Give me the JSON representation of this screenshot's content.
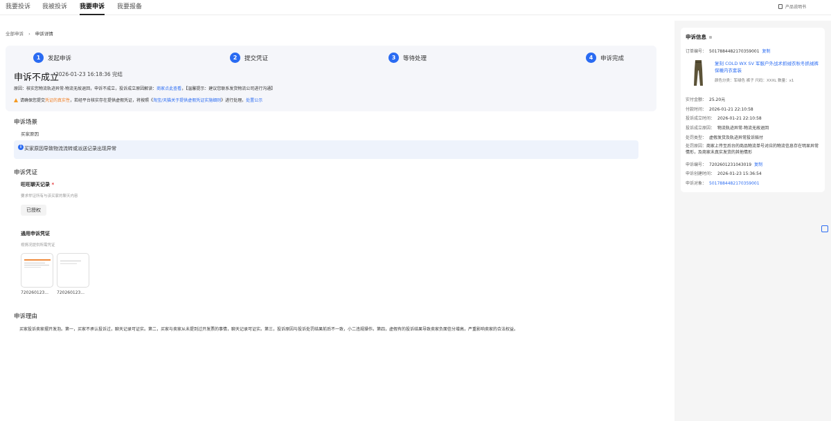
{
  "nav": {
    "tabs": [
      {
        "label": "我要投诉"
      },
      {
        "label": "我被投诉"
      },
      {
        "label": "我要申诉"
      },
      {
        "label": "我要报备"
      }
    ],
    "help": "产品说明书"
  },
  "breadcrumb": {
    "root": "全部申诉",
    "sep": "›",
    "current": "申诉详情"
  },
  "steps": [
    {
      "num": "1",
      "label": "发起申诉"
    },
    {
      "num": "2",
      "label": "提交凭证"
    },
    {
      "num": "3",
      "label": "等待处理"
    },
    {
      "num": "4",
      "label": "申诉完成"
    }
  ],
  "status": {
    "title": "申诉不成立",
    "time": "2026-01-23 16:18:36 完结",
    "reason_prefix": "原因：核实您物流轨迹异常-物流无故退回，申诉不成立，投诉成立原因解读：",
    "reason_link": "商家点此查看",
    "reason_suffix": "，【温馨提示：建议您联系发货物流公司进行沟通】",
    "warn_prefix": "请确保您提交",
    "warn_orange": "凭证的真实性",
    "warn_mid": "，若经平台核实存在提供虚假凭证，将按照《",
    "warn_link1": "淘宝/天猫关于提供虚假凭证实施细则",
    "warn_after": "》进行处理。",
    "warn_link2": "处置公示"
  },
  "scene": {
    "title": "申诉场景",
    "sub": "买家原因",
    "info": "买家原因导致物流流转或派送记录出现异常"
  },
  "evidence": {
    "title": "申诉凭证",
    "chat_label": "旺旺聊天记录",
    "required_mark": "*",
    "chat_hint": "要求举证所有与该买家的聊天内容",
    "auth_button": "已授权",
    "general_label": "通用申诉凭证",
    "general_hint": "视情况提供所需凭证",
    "files": [
      {
        "name": "720260123..."
      },
      {
        "name": "720260123..."
      }
    ]
  },
  "reason": {
    "title": "申诉理由",
    "text": "买家投诉卖家摆开发泡。第一，买家不承认投诉过，聊天记录可证实。第二，买家与卖家从未提到过开发票的事情，聊天记录可证实。第三，投诉原因与投诉处罚结果前后不一致，小二违规操作。第四，虚假有的投诉结果导致卖家负面信分增高，严重影响卖家的合法权益。"
  },
  "right": {
    "title": "申诉信息",
    "order_label": "订单编号：",
    "order_value": "5017884482170359001",
    "copy": "复制",
    "product_name": "复刻 COLD WX SV 军服户外战术抓绒衣秋冬抓绒裤保暖内衣套装",
    "product_spec": "颜色分类：军绿色 裤子 尺码：XXXL 数量：x1",
    "rows": [
      {
        "label": "实付金额：",
        "value": "25.20元"
      },
      {
        "label": "付款时间：",
        "value": "2026-01-21 22:10:58"
      },
      {
        "label": "投诉成立时间：",
        "value": "2026-01-21 22:10:58"
      },
      {
        "label": "投诉成立原因：",
        "value": "物流轨迹异常-物流无故退回"
      },
      {
        "label": "处罚类型：",
        "value": "虚假发货及轨迹异常投诉赔付"
      }
    ],
    "punish_reason_label": "处罚原因：",
    "punish_reason_value": "商家上传至后台的商品物流单号对应的物流信息存在明显异常情形，及商家未真实发货的其他情形",
    "appeal_no_label": "申诉编号：",
    "appeal_no_value": "7202601231043019",
    "created_label": "申诉创建时间：",
    "created_value": "2026-01-23 15:36:54",
    "target_label": "申诉对象：",
    "target_value": "5017884482170359001"
  },
  "colors": {
    "accent": "#2a6bf2",
    "warn": "#f59a23"
  }
}
